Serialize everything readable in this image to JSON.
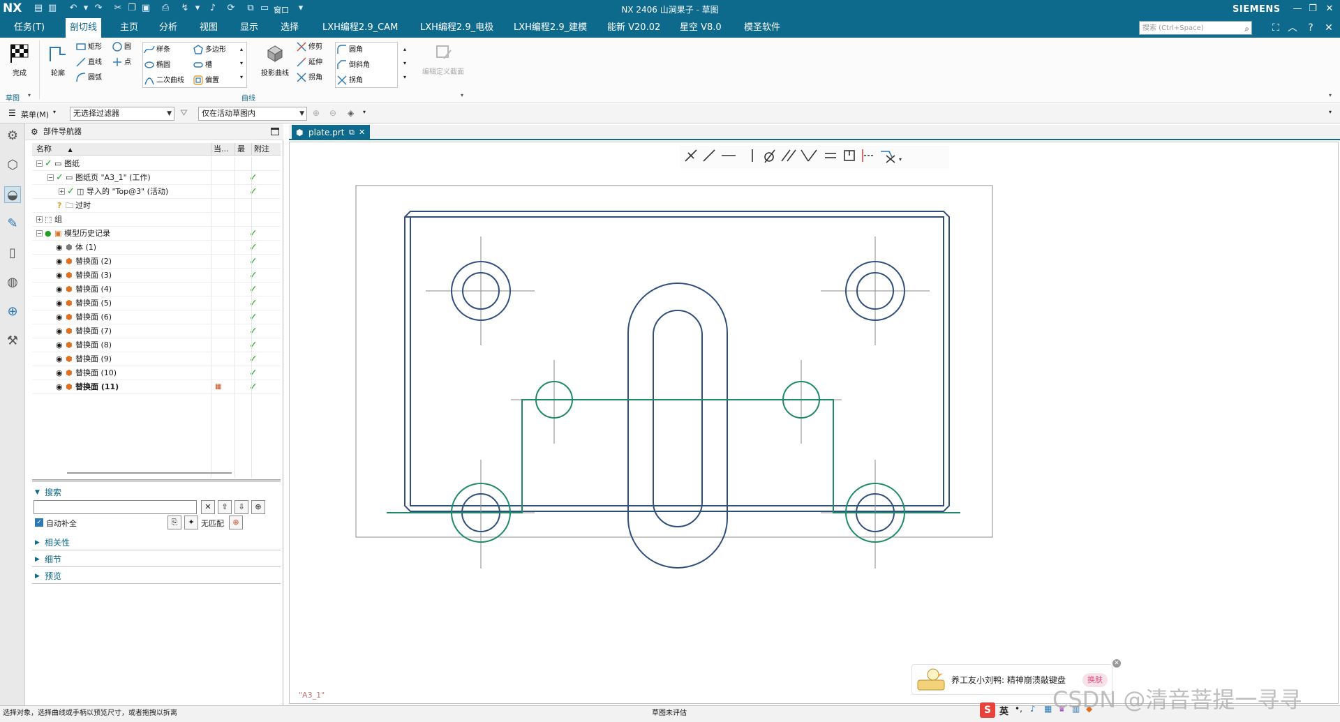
{
  "app": {
    "logo": "NX",
    "title": "NX 2406 山涧果子 - 草图",
    "brand": "SIEMENS",
    "window_menu": "窗口",
    "search_placeholder": "搜索 (Ctrl+Space)"
  },
  "menubar": {
    "items": [
      "任务(T)",
      "剖切线",
      "主页",
      "分析",
      "视图",
      "显示",
      "选择",
      "LXH编程2.9_CAM",
      "LXH编程2.9_电极",
      "LXH编程2.9_建模",
      "能新 V20.02",
      "星空 V8.0",
      "模圣软件"
    ],
    "active_index": 1
  },
  "ribbon": {
    "finish": "完成",
    "profile": "轮廓",
    "rectangle": "矩形",
    "circle": "圆",
    "line": "直线",
    "point": "点",
    "arc": "圆弧",
    "spline": "样条",
    "polygon": "多边形",
    "ellipse": "椭圆",
    "slot": "槽",
    "conic": "二次曲线",
    "offset": "偏置",
    "project_curve": "投影曲线",
    "trim": "修剪",
    "extend": "延伸",
    "corner": "拐角",
    "fillet": "圆角",
    "chamfer": "倒斜角",
    "corner2": "拐角",
    "edit_section": "编辑定义截面",
    "group_sketch": "草图",
    "group_curve": "曲线"
  },
  "selbar": {
    "menu": "菜单(M)",
    "filter": "无选择过滤器",
    "scope": "仅在活动草图内"
  },
  "navigator": {
    "title": "部件导航器",
    "columns": [
      "名称",
      "当...",
      "最",
      "附注"
    ],
    "rows": [
      {
        "label": "图纸",
        "indent": 0,
        "check": true,
        "latest": false
      },
      {
        "label": "图纸页 \"A3_1\" (工作)",
        "indent": 1,
        "check": true,
        "latest": true
      },
      {
        "label": "导入的 \"Top@3\" (活动)",
        "indent": 2,
        "check": true,
        "latest": true
      },
      {
        "label": "过时",
        "indent": 1,
        "check": false,
        "latest": false
      },
      {
        "label": "组",
        "indent": 0,
        "check": false,
        "latest": false
      },
      {
        "label": "模型历史记录",
        "indent": 0,
        "check": false,
        "latest": true
      },
      {
        "label": "体 (1)",
        "indent": 1,
        "check": false,
        "latest": true
      },
      {
        "label": "替换面 (2)",
        "indent": 1,
        "check": false,
        "latest": true
      },
      {
        "label": "替换面 (3)",
        "indent": 1,
        "check": false,
        "latest": true
      },
      {
        "label": "替换面 (4)",
        "indent": 1,
        "check": false,
        "latest": true
      },
      {
        "label": "替换面 (5)",
        "indent": 1,
        "check": false,
        "latest": true
      },
      {
        "label": "替换面 (6)",
        "indent": 1,
        "check": false,
        "latest": true
      },
      {
        "label": "替换面 (7)",
        "indent": 1,
        "check": false,
        "latest": true
      },
      {
        "label": "替换面 (8)",
        "indent": 1,
        "check": false,
        "latest": true
      },
      {
        "label": "替换面 (9)",
        "indent": 1,
        "check": false,
        "latest": true
      },
      {
        "label": "替换面 (10)",
        "indent": 1,
        "check": false,
        "latest": true
      },
      {
        "label": "替换面 (11)",
        "indent": 1,
        "check": false,
        "latest": true
      }
    ],
    "search_heading": "搜索",
    "auto_complete": "自动补全",
    "no_match": "无匹配",
    "dependencies": "相关性",
    "details": "细节",
    "preview": "预览"
  },
  "tab": {
    "label": "plate.prt"
  },
  "canvas": {
    "sheet_label": "\"A3_1\""
  },
  "status": {
    "left": "选择对象，选择曲线或手柄以预览尺寸，或者拖拽以拆离",
    "center": "草图未评估"
  },
  "ime": {
    "message": "养工友小刘鸭: 精神崩溃敲键盘",
    "button": "换肤",
    "lang": "英"
  },
  "watermark": "CSDN @清音菩提一寻寻",
  "colors": {
    "titlebar": "#0e6a8c",
    "drawing_blue": "#2f4e7c",
    "drawing_green": "#1f8a6a"
  }
}
